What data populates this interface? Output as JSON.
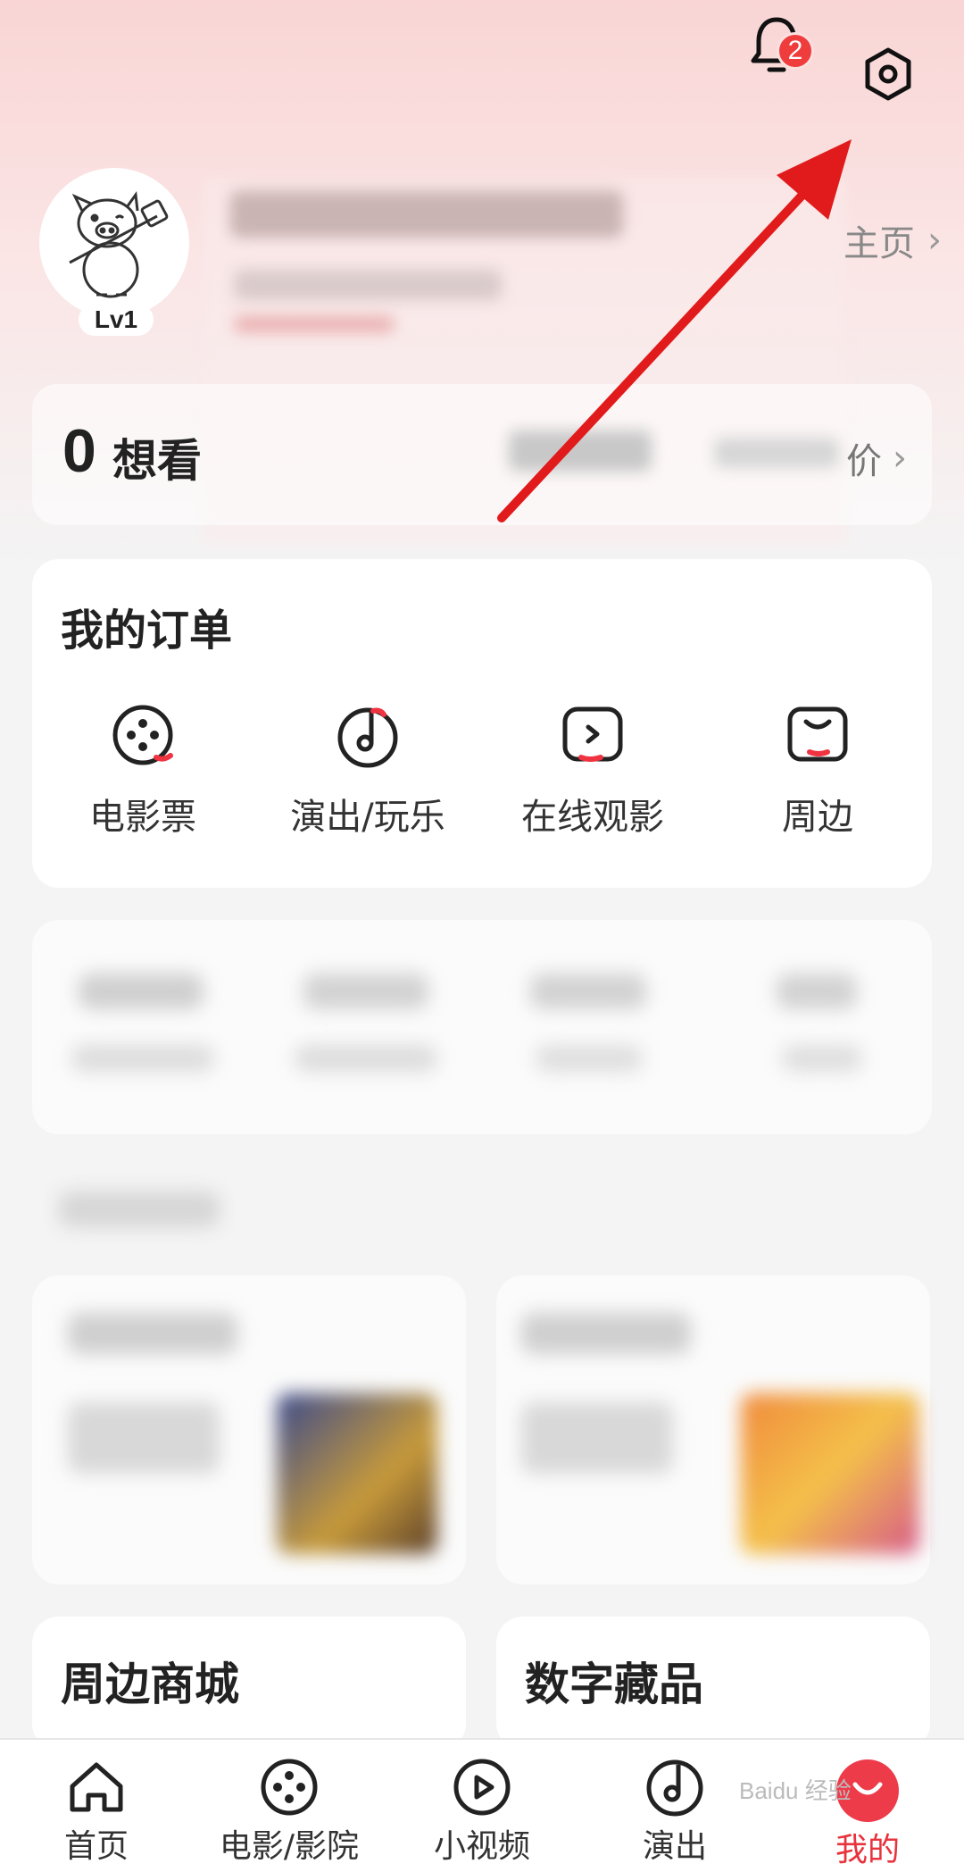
{
  "header": {
    "notification_count": "2"
  },
  "profile": {
    "level": "Lv1",
    "homepage_link": "主页"
  },
  "stats": {
    "want_count": "0",
    "want_label": "想看",
    "evaluation_link": "价"
  },
  "orders": {
    "title": "我的订单",
    "items": [
      {
        "label": "电影票",
        "icon": "film-reel-icon"
      },
      {
        "label": "演出/玩乐",
        "icon": "music-note-icon"
      },
      {
        "label": "在线观影",
        "icon": "play-screen-icon"
      },
      {
        "label": "周边",
        "icon": "shopping-bag-icon"
      }
    ]
  },
  "cards": {
    "merch_mall": "周边商城",
    "digital_collectibles": "数字藏品"
  },
  "tabbar": {
    "items": [
      {
        "label": "首页",
        "icon": "home-icon"
      },
      {
        "label": "电影/影院",
        "icon": "film-reel-icon"
      },
      {
        "label": "小视频",
        "icon": "play-circle-icon"
      },
      {
        "label": "演出",
        "icon": "music-disc-icon"
      },
      {
        "label": "我的",
        "icon": "profile-icon",
        "active": true
      }
    ]
  },
  "colors": {
    "accent": "#e8323c",
    "annotation_arrow": "#e11b1b"
  }
}
